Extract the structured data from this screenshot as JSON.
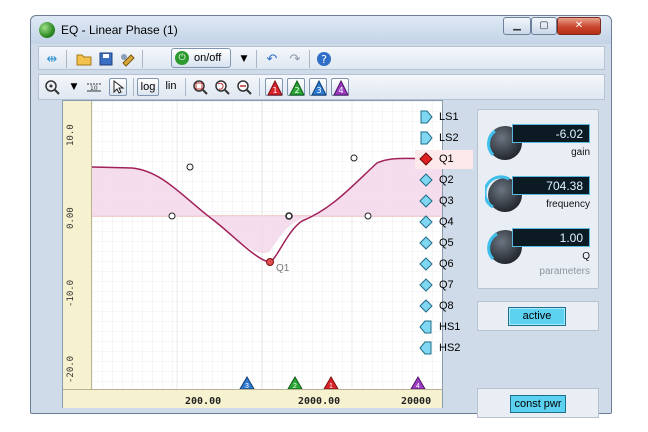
{
  "window": {
    "title": "EQ - Linear Phase (1)"
  },
  "toolbar1": {
    "onoff_label": "on/off",
    "power_symbol": "⏻"
  },
  "toolbar2": {
    "log_label": "log",
    "lin_label": "lin",
    "band_tags": [
      "1",
      "2",
      "3",
      "4"
    ]
  },
  "plot": {
    "y_labels": [
      "10.0",
      "0.00",
      "-10.0",
      "-20.0"
    ],
    "x_labels": [
      "200.00",
      "2000.00",
      "20000"
    ],
    "point_label": "Q1",
    "markers": [
      "3",
      "2",
      "1",
      "4"
    ]
  },
  "bands": [
    {
      "label": "LS1",
      "icon": "low-shelf-icon"
    },
    {
      "label": "LS2",
      "icon": "low-shelf-icon"
    },
    {
      "label": "Q1",
      "icon": "peak-icon",
      "selected": true
    },
    {
      "label": "Q2",
      "icon": "peak-icon"
    },
    {
      "label": "Q3",
      "icon": "peak-icon"
    },
    {
      "label": "Q4",
      "icon": "peak-icon"
    },
    {
      "label": "Q5",
      "icon": "peak-icon"
    },
    {
      "label": "Q6",
      "icon": "peak-icon"
    },
    {
      "label": "Q7",
      "icon": "peak-icon"
    },
    {
      "label": "Q8",
      "icon": "peak-icon"
    },
    {
      "label": "HS1",
      "icon": "high-shelf-icon"
    },
    {
      "label": "HS2",
      "icon": "high-shelf-icon"
    }
  ],
  "params": {
    "gain_value": "-6.02",
    "gain_label": "gain",
    "freq_value": "704.38",
    "freq_label": "frequency",
    "q_value": "1.00",
    "q_label": "Q",
    "section_label": "parameters"
  },
  "active_label": "active",
  "constpwr_label": "const pwr",
  "colors": {
    "curve": "#a0205a",
    "fill": "#f2d9ea",
    "lcd_border": "#5bb9e0",
    "active": "#5cd1f0"
  }
}
